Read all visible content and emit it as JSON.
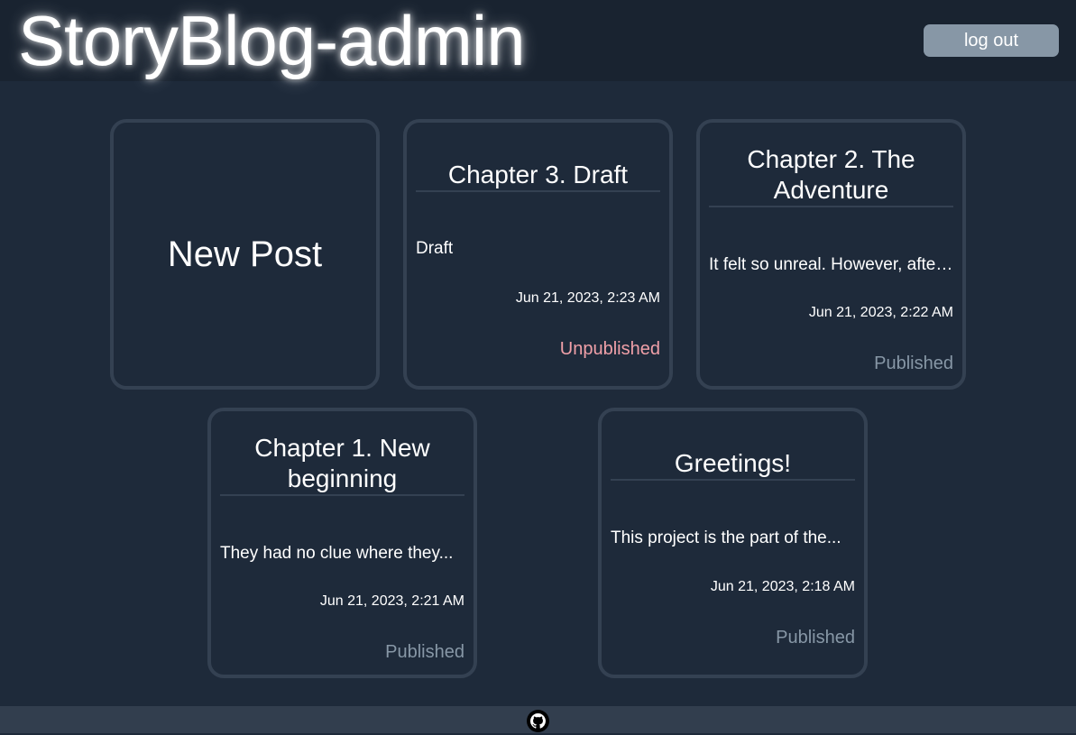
{
  "header": {
    "title": "StoryBlog-admin",
    "logout_label": "log out"
  },
  "new_post": {
    "label": "New Post"
  },
  "posts": [
    {
      "title": "Chapter 3. Draft",
      "excerpt": "Draft",
      "date": "Jun 21, 2023, 2:23 AM",
      "status": "Unpublished"
    },
    {
      "title": "Chapter 2. The Adventure",
      "excerpt": "It felt so unreal. However, after...",
      "date": "Jun 21, 2023, 2:22 AM",
      "status": "Published"
    },
    {
      "title": "Chapter 1. New beginning",
      "excerpt": "They had no clue where they...",
      "date": "Jun 21, 2023, 2:21 AM",
      "status": "Published"
    },
    {
      "title": "Greetings!",
      "excerpt": "This project is the part of the...",
      "date": "Jun 21, 2023, 2:18 AM",
      "status": "Published"
    }
  ],
  "footer": {
    "icon": "github-icon"
  },
  "colors": {
    "background": "#1e2a3a",
    "header_bg": "#192330",
    "card_border": "#344152",
    "button_bg": "#8797a6",
    "published": "#8797a6",
    "unpublished": "#f0a0a8",
    "footer_bg": "#323e4e"
  }
}
